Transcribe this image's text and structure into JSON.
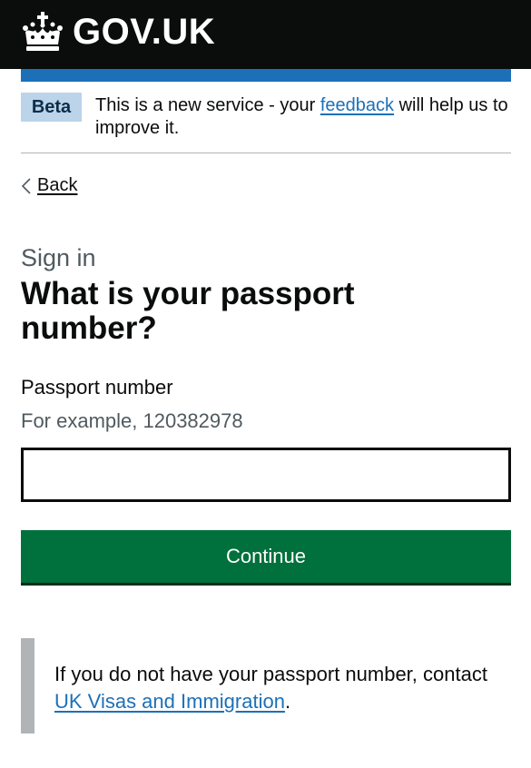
{
  "header": {
    "logo_text": "GOV.UK",
    "brand_color": "#0b0c0c",
    "accent_color": "#1d70b8"
  },
  "phase_banner": {
    "tag": "Beta",
    "text_before": "This is a new service - your ",
    "link": "feedback",
    "text_after": " will help us to improve it."
  },
  "back_link": {
    "label": "Back"
  },
  "page": {
    "caption": "Sign in",
    "heading": "What is your passport number?"
  },
  "form": {
    "label": "Passport number",
    "hint": "For example, 120382978",
    "value": "",
    "button_label": "Continue",
    "button_color": "#00703c"
  },
  "inset": {
    "text_before": "If you do not have your passport number, contact ",
    "link": "UK Visas and Immigration",
    "text_after": "."
  }
}
